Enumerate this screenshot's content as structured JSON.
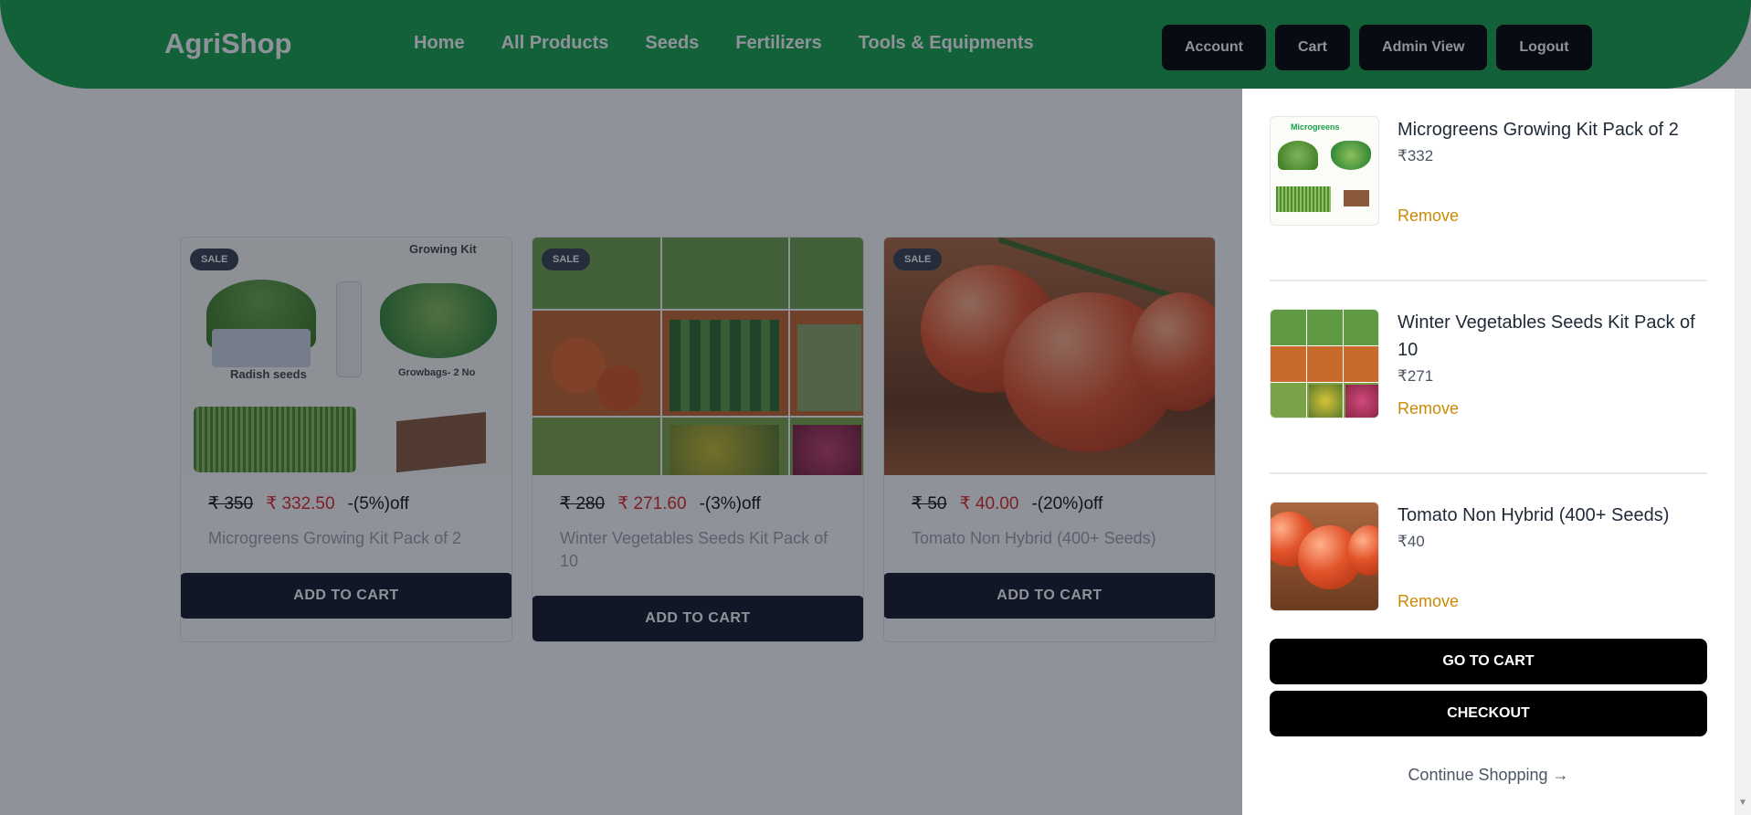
{
  "header": {
    "logo": "AgriShop",
    "nav": [
      "Home",
      "All Products",
      "Seeds",
      "Fertilizers",
      "Tools & Equipments"
    ],
    "actions": [
      "Account",
      "Cart",
      "Admin View",
      "Logout"
    ],
    "brand_color": "#16a34a"
  },
  "products": [
    {
      "badge": "SALE",
      "old_price": "₹ 350",
      "new_price": "₹ 332.50",
      "discount": "-(5%)off",
      "name": "Microgreens Growing Kit Pack of 2",
      "button": "ADD TO CART",
      "image_labels": [
        "Growing Kit",
        "Radish seeds",
        "Growbags- 2 No"
      ]
    },
    {
      "badge": "SALE",
      "old_price": "₹ 280",
      "new_price": "₹ 271.60",
      "discount": "-(3%)off",
      "name": "Winter Vegetables Seeds Kit Pack of 10",
      "button": "ADD TO CART"
    },
    {
      "badge": "SALE",
      "old_price": "₹ 50",
      "new_price": "₹ 40.00",
      "discount": "-(20%)off",
      "name": "Tomato Non Hybrid (400+ Seeds)",
      "button": "ADD TO CART"
    }
  ],
  "cart": {
    "items": [
      {
        "name": "Microgreens Growing Kit Pack of 2",
        "price": "₹332",
        "remove": "Remove",
        "thumb_label": "Microgreens"
      },
      {
        "name": "Winter Vegetables Seeds Kit Pack of 10",
        "price": "₹271",
        "remove": "Remove"
      },
      {
        "name": "Tomato Non Hybrid (400+ Seeds)",
        "price": "₹40",
        "remove": "Remove"
      }
    ],
    "go_to_cart": "GO TO CART",
    "checkout": "CHECKOUT",
    "continue": "Continue Shopping →",
    "remove_color": "#ca8a04"
  }
}
